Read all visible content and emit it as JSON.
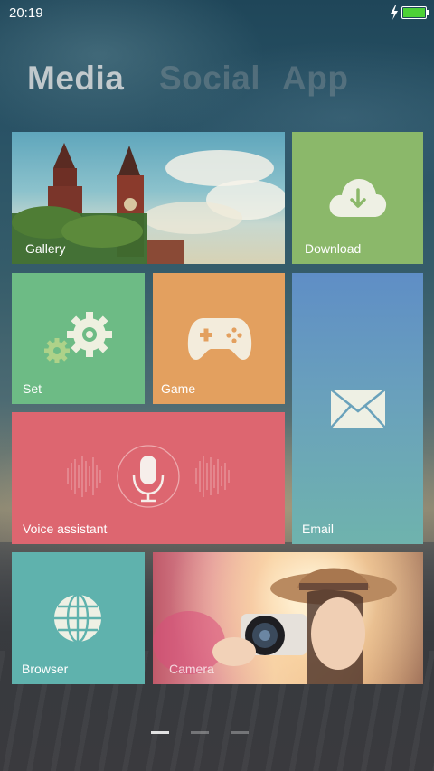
{
  "status_bar": {
    "time": "20:19",
    "icons": [
      "charging-icon",
      "battery-icon"
    ],
    "battery_color": "#4cd137"
  },
  "tabs": [
    {
      "label": "Media",
      "active": true
    },
    {
      "label": "Social",
      "active": false
    },
    {
      "label": "App",
      "active": false
    }
  ],
  "tiles": {
    "gallery": {
      "label": "Gallery",
      "image": "kremlin-towers-photo"
    },
    "download": {
      "label": "Download",
      "color": "#8bb86a",
      "icon": "cloud-download-icon"
    },
    "set": {
      "label": "Set",
      "color": "#6dbb85",
      "icon": "gears-icon"
    },
    "game": {
      "label": "Game",
      "color": "#e3a05f",
      "icon": "gamepad-icon"
    },
    "email": {
      "label": "Email",
      "gradient": [
        "#5f8ec6",
        "#6fb3ad"
      ],
      "icon": "envelope-icon"
    },
    "voice": {
      "label": "Voice assistant",
      "color": "#dd6670",
      "icon": "microphone-icon"
    },
    "browser": {
      "label": "Browser",
      "color": "#5fb2ad",
      "icon": "globe-icon"
    },
    "camera": {
      "label": "Camera",
      "image": "girl-with-camera-photo"
    }
  },
  "pager": {
    "pages": 3,
    "current": 0
  }
}
